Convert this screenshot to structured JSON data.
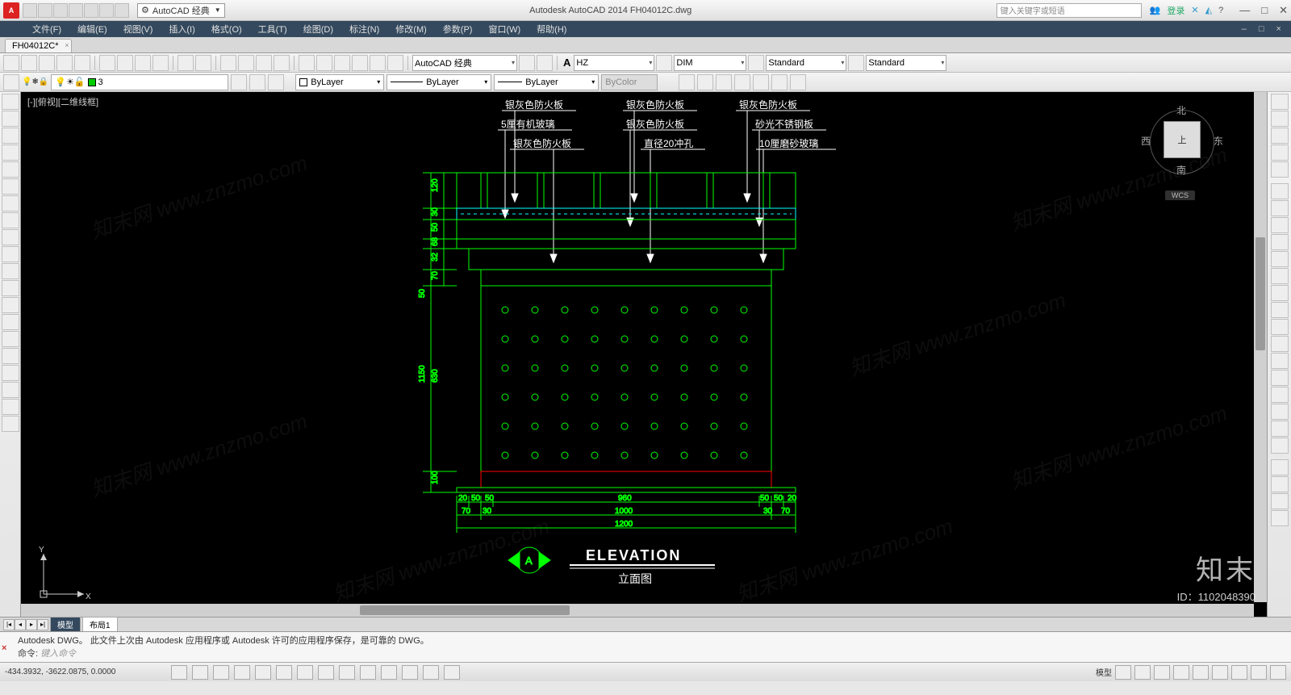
{
  "app": {
    "title_center": "Autodesk AutoCAD 2014    FH04012C.dwg",
    "workspace": "AutoCAD 经典",
    "search_placeholder": "键入关键字或短语",
    "login": "登录",
    "win_min": "—",
    "win_max": "□",
    "win_close": "✕"
  },
  "menubar": {
    "items": [
      "文件(F)",
      "编辑(E)",
      "视图(V)",
      "插入(I)",
      "格式(O)",
      "工具(T)",
      "绘图(D)",
      "标注(N)",
      "修改(M)",
      "参数(P)",
      "窗口(W)",
      "帮助(H)"
    ]
  },
  "doc_tab": {
    "name": "FH04012C*",
    "close": "×"
  },
  "toolbar1": {
    "workspace_sel": "AutoCAD 经典",
    "textstyle_prefix_icon": "A",
    "textstyle": "HZ",
    "dimstyle": "DIM",
    "tablestyle": "Standard",
    "mlstyle": "Standard"
  },
  "layer_row": {
    "layer_name": "3",
    "color": "ByLayer",
    "linetype": "ByLayer",
    "lineweight": "ByLayer",
    "plotstyle": "ByColor"
  },
  "viewport": {
    "label": "[-][俯视][二维线框]",
    "viewcube": {
      "n": "北",
      "s": "南",
      "e": "东",
      "w": "西",
      "top": "上",
      "wcs": "WCS"
    },
    "ucs": {
      "x": "X",
      "y": "Y"
    }
  },
  "drawing": {
    "labels": {
      "l1": "银灰色防火板",
      "l2": "银灰色防火板",
      "l3": "银灰色防火板",
      "l4": "5厘有机玻璃",
      "l5": "银灰色防火板",
      "l6": "砂光不锈钢板",
      "l7": "银灰色防火板",
      "l8": "直径20冲孔",
      "l9": "10厘磨砂玻璃"
    },
    "dims": {
      "v_120": "120",
      "v_30": "30",
      "v_50a": "50",
      "v_68": "68",
      "v_32": "32",
      "v_70": "70",
      "v_50b": "50",
      "v_1150": "1150",
      "v_630": "630",
      "v_100": "100",
      "h_20a": "20",
      "h_50a": "50",
      "h_50b": "50",
      "h_960": "960",
      "h_50c": "50",
      "h_50d": "50",
      "h_20b": "20",
      "h_70a": "70",
      "h_30a": "30",
      "h_1000": "1000",
      "h_30b": "30",
      "h_70b": "70",
      "h_1200": "1200"
    },
    "title_en": "ELEVATION",
    "title_cn": "立面图",
    "section_mark": "A"
  },
  "model_tabs": {
    "model": "模型",
    "layout1": "布局1"
  },
  "cmd": {
    "history": "Autodesk DWG。  此文件上次由 Autodesk 应用程序或 Autodesk 许可的应用程序保存，是可靠的 DWG。",
    "prompt_label": "命令:",
    "prompt_hint": "键入命令"
  },
  "status": {
    "coords": "-434.3932,  -3622.0875,  0.0000",
    "right_label": "模型"
  },
  "watermark": {
    "brand": "知末",
    "id": "ID：1102048390",
    "wm_text": "知末网 www.znzmo.com"
  }
}
